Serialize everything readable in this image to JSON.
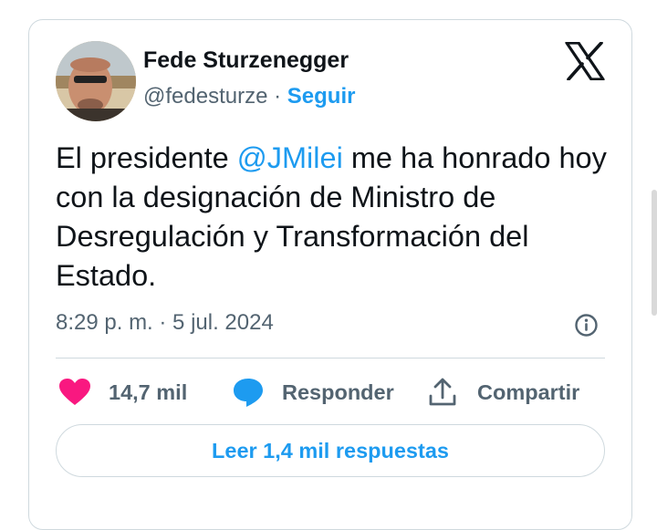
{
  "author": {
    "name": "Fede Sturzenegger",
    "handle": "@fedesturze",
    "separator": "·",
    "follow_label": "Seguir"
  },
  "tweet": {
    "text_before": "El presidente ",
    "mention": "@JMilei",
    "text_after": " me ha honrado hoy con la designación de Ministro de Desregulación y Transformación del Estado."
  },
  "meta": {
    "timestamp": "8:29 p. m. · 5 jul. 2024"
  },
  "actions": {
    "likes": "14,7 mil",
    "reply_label": "Responder",
    "share_label": "Compartir"
  },
  "read_replies_label": "Leer 1,4 mil respuestas",
  "icons": {
    "logo": "x-logo-icon",
    "info": "info-icon",
    "like": "heart-icon",
    "reply": "speech-bubble-icon",
    "share": "share-icon"
  },
  "colors": {
    "accent": "#1d9bf0",
    "heart": "#f91880",
    "secondary_text": "#536471"
  }
}
